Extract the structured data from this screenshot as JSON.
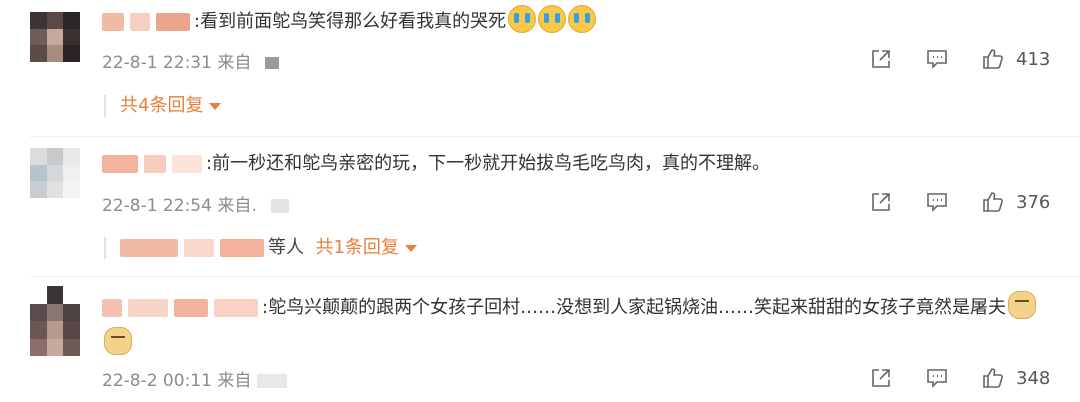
{
  "comments": [
    {
      "text": ":看到前面鸵鸟笑得那么好看我真的哭死",
      "emojis": [
        "crying-face",
        "crying-face",
        "crying-face"
      ],
      "time": "22-8-1 22:31 来自",
      "likes": "413",
      "replies_label": "共4条回复"
    },
    {
      "text": ":前一秒还和鸵鸟亲密的玩，下一秒就开始拔鸟毛吃鸟肉，真的不理解。",
      "time": "22-8-1 22:54 来自.",
      "likes": "376",
      "replies_others": "等人",
      "replies_label": "共1条回复"
    },
    {
      "text": ":鸵鸟兴颠颠的跟两个女孩子回村……没想到人家起锅烧油……笑起来甜甜的女孩子竟然是屠夫",
      "emojis": [
        "doge",
        "doge"
      ],
      "time": "22-8-2 00:11 来自",
      "likes": "348"
    }
  ],
  "colors": {
    "accent": "#e6803b",
    "meta": "#8c8c8c"
  }
}
